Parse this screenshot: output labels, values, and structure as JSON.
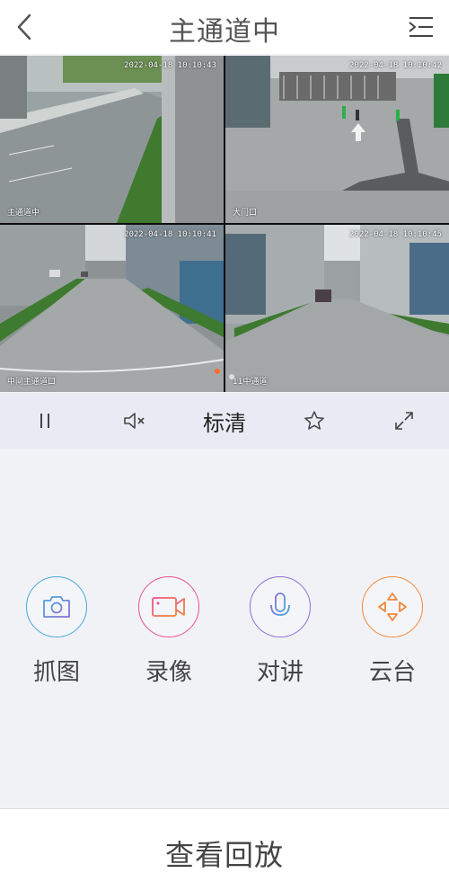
{
  "header": {
    "title": "主通道中",
    "back_icon": "chevron-left-icon",
    "menu_icon": "list-menu-icon"
  },
  "cameras": [
    {
      "timestamp": "2022-04-18 10:10:43",
      "name": "主通道中"
    },
    {
      "timestamp": "2022-04-18 10:10:42",
      "name": "大门口"
    },
    {
      "timestamp": "2022-04-18 10:10:41",
      "name": "中间主通道口"
    },
    {
      "timestamp": "2022-04-18 10:10:45",
      "name": "11中通道"
    }
  ],
  "toolbar": {
    "pause_icon": "pause-icon",
    "mute_icon": "mute-icon",
    "quality_label": "标清",
    "favorite_icon": "star-icon",
    "fullscreen_icon": "fullscreen-icon"
  },
  "functions": [
    {
      "label": "抓图",
      "icon": "camera-icon",
      "color": "#4aa8d8"
    },
    {
      "label": "录像",
      "icon": "video-camera-icon",
      "color": "#ee4f8c"
    },
    {
      "label": "对讲",
      "icon": "microphone-icon",
      "color": "#8a6fd4"
    },
    {
      "label": "云台",
      "icon": "ptz-direction-icon",
      "color": "#f0883a"
    }
  ],
  "bottom": {
    "playback_label": "查看回放"
  }
}
